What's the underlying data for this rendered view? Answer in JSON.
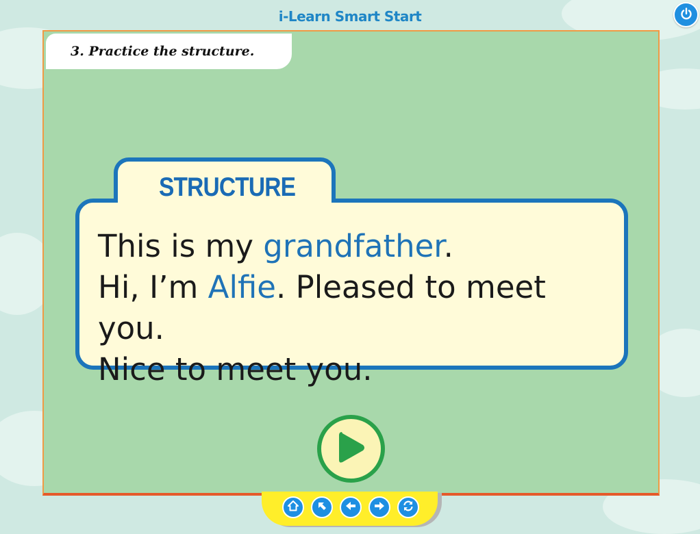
{
  "app": {
    "title": "i-Learn Smart Start"
  },
  "instruction": "3. Practice the structure.",
  "structure_card": {
    "heading": "STRUCTURE",
    "line1": {
      "before": "This is my ",
      "highlight": "grandfather",
      "after": "."
    },
    "line2": {
      "before": "Hi, I’m ",
      "highlight": "Alfie",
      "after": ". Pleased to meet you."
    },
    "line3": "Nice to meet you."
  },
  "controls": {
    "power_icon": "power-icon",
    "play_icon": "play-icon",
    "nav_icons": [
      "home-icon",
      "up-left-arrow-icon",
      "left-arrow-icon",
      "right-arrow-icon",
      "refresh-icon"
    ]
  },
  "colors": {
    "stage_bg": "#a8d8ab",
    "card_border": "#1c75bb",
    "highlight": "#1f73b7",
    "play_ring": "#2aa14a",
    "nav_bar": "#ffee2a",
    "nav_button": "#1e8fe2"
  }
}
